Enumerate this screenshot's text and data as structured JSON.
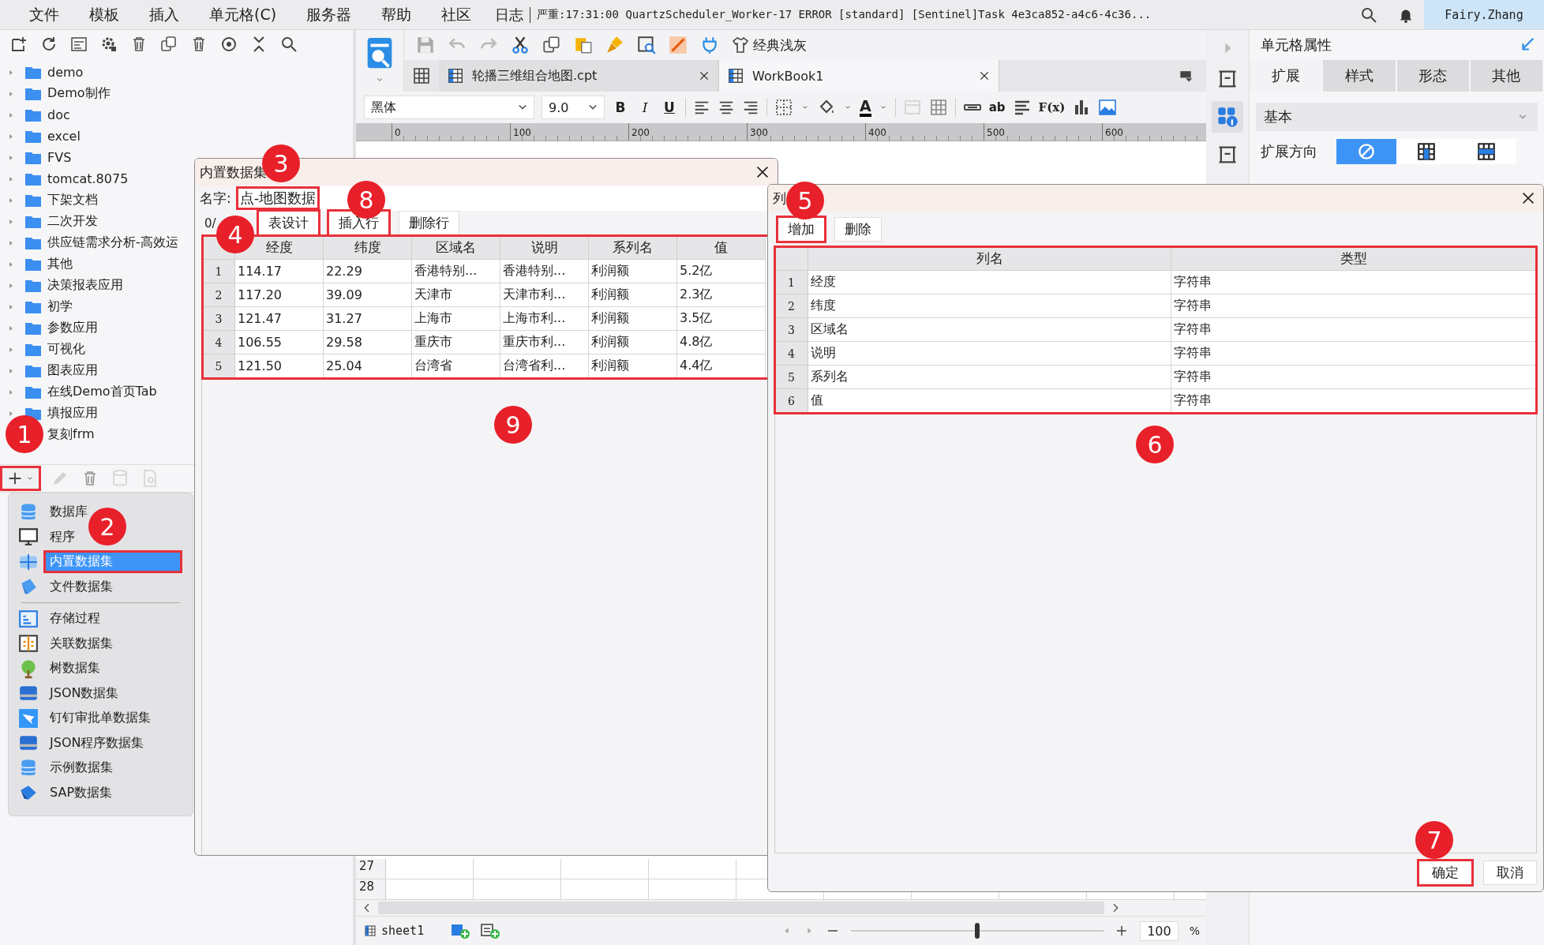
{
  "menu_bar": {
    "items": [
      "文件",
      "模板",
      "插入",
      "单元格(C)",
      "服务器",
      "帮助",
      "社区"
    ],
    "log_label": "日志",
    "log_message": "严重:17:31:00 QuartzScheduler_Worker-17 ERROR [standard] [Sentinel]Task 4e3ca852-a4c6-4c36...",
    "user": "Fairy.Zhang"
  },
  "template_tree": {
    "items": [
      {
        "label": "demo"
      },
      {
        "label": "Demo制作"
      },
      {
        "label": "doc"
      },
      {
        "label": "excel"
      },
      {
        "label": "FVS"
      },
      {
        "label": "tomcat.8075"
      },
      {
        "label": "下架文档"
      },
      {
        "label": "二次开发"
      },
      {
        "label": "供应链需求分析-高效运"
      },
      {
        "label": "其他"
      },
      {
        "label": "决策报表应用"
      },
      {
        "label": "初学"
      },
      {
        "label": "参数应用"
      },
      {
        "label": "可视化"
      },
      {
        "label": "图表应用"
      },
      {
        "label": "在线Demo首页Tab"
      },
      {
        "label": "填报应用"
      },
      {
        "label": "复刻frm"
      }
    ]
  },
  "data_toolbar": {
    "add_button": {
      "highlighted": true
    }
  },
  "add_menu": {
    "sections": [
      {
        "items": [
          {
            "label": "数据库",
            "selected": false,
            "highlighted": false
          },
          {
            "label": "程序",
            "selected": false,
            "highlighted": false
          },
          {
            "label": "内置数据集",
            "selected": true,
            "highlighted": true
          },
          {
            "label": "文件数据集",
            "selected": false,
            "highlighted": false
          }
        ]
      },
      {
        "items": [
          {
            "label": "存储过程",
            "selected": false,
            "highlighted": false
          },
          {
            "label": "关联数据集",
            "selected": false,
            "highlighted": false
          },
          {
            "label": "树数据集",
            "selected": false,
            "highlighted": false
          },
          {
            "label": "JSON数据集",
            "selected": false,
            "highlighted": false
          },
          {
            "label": "钉钉审批单数据集",
            "selected": false,
            "highlighted": false
          },
          {
            "label": "JSON程序数据集",
            "selected": false,
            "highlighted": false
          },
          {
            "label": "示例数据集",
            "selected": false,
            "highlighted": false
          },
          {
            "label": "SAP数据集",
            "selected": false,
            "highlighted": false
          }
        ]
      }
    ]
  },
  "editor": {
    "theme_button": "经典浅灰",
    "tabs": [
      {
        "label": "轮播三维组合地图.cpt",
        "selected": false
      },
      {
        "label": "WorkBook1",
        "selected": true
      }
    ],
    "font": "黑体",
    "font_size": "9.0",
    "style_buttons": [
      "B",
      "I",
      "U"
    ],
    "font_color_glyph": "A",
    "text_tools": [
      "ab",
      "F(x)"
    ],
    "ruler": [
      "0",
      "100",
      "200",
      "300",
      "400",
      "500",
      "600"
    ],
    "row_numbers": [
      "27",
      "28"
    ],
    "sheet_tab": "sheet1",
    "zoom_slider": {
      "level": 0.5
    },
    "zoom": "100",
    "zoom_unit": "%"
  },
  "cell_properties": {
    "title": "单元格属性",
    "tabs": [
      {
        "label": "扩展",
        "selected": true
      },
      {
        "label": "样式",
        "selected": false
      },
      {
        "label": "形态",
        "selected": false
      },
      {
        "label": "其他",
        "selected": false
      }
    ],
    "section": "基本",
    "direction_label": "扩展方向",
    "direction_options": [
      {
        "kind": "none",
        "selected": true
      },
      {
        "kind": "vertical",
        "selected": false
      },
      {
        "kind": "horizontal",
        "selected": false
      }
    ]
  },
  "dataset_dialog": {
    "title": "内置数据集",
    "name_label": "名字:",
    "name_value": "点-地图数据",
    "name_highlighted": true,
    "row_count": "0/",
    "buttons": [
      {
        "label": "表设计",
        "highlighted": true
      },
      {
        "label": "插入行",
        "highlighted": true
      },
      {
        "label": "删除行",
        "highlighted": false
      }
    ],
    "table": {
      "highlighted": true,
      "columns": [
        "经度",
        "纬度",
        "区域名",
        "说明",
        "系列名",
        "值"
      ],
      "rows": [
        {
          "index": "1",
          "cells": [
            "114.17",
            "22.29",
            "香港特别...",
            "香港特别...",
            "利润额",
            "5.2亿"
          ]
        },
        {
          "index": "2",
          "cells": [
            "117.20",
            "39.09",
            "天津市",
            "天津市利...",
            "利润额",
            "2.3亿"
          ]
        },
        {
          "index": "3",
          "cells": [
            "121.47",
            "31.27",
            "上海市",
            "上海市利...",
            "利润额",
            "3.5亿"
          ]
        },
        {
          "index": "4",
          "cells": [
            "106.55",
            "29.58",
            "重庆市",
            "重庆市利...",
            "利润额",
            "4.8亿"
          ]
        },
        {
          "index": "5",
          "cells": [
            "121.50",
            "25.04",
            "台湾省",
            "台湾省利...",
            "利润额",
            "4.4亿"
          ]
        }
      ]
    }
  },
  "columns_dialog": {
    "title": "列",
    "buttons": [
      {
        "label": "增加",
        "highlighted": true
      },
      {
        "label": "删除",
        "highlighted": false
      }
    ],
    "table": {
      "highlighted": true,
      "columns": [
        "列名",
        "类型"
      ],
      "rows": [
        {
          "index": "1",
          "cells": [
            "经度",
            "字符串"
          ]
        },
        {
          "index": "2",
          "cells": [
            "纬度",
            "字符串"
          ]
        },
        {
          "index": "3",
          "cells": [
            "区域名",
            "字符串"
          ]
        },
        {
          "index": "4",
          "cells": [
            "说明",
            "字符串"
          ]
        },
        {
          "index": "5",
          "cells": [
            "系列名",
            "字符串"
          ]
        },
        {
          "index": "6",
          "cells": [
            "值",
            "字符串"
          ]
        }
      ]
    },
    "footer_buttons": [
      {
        "label": "确定",
        "highlighted": true
      },
      {
        "label": "取消",
        "highlighted": false
      }
    ]
  },
  "callouts": [
    {
      "number": "1"
    },
    {
      "number": "2"
    },
    {
      "number": "3"
    },
    {
      "number": "4"
    },
    {
      "number": "5"
    },
    {
      "number": "6"
    },
    {
      "number": "7"
    },
    {
      "number": "8"
    },
    {
      "number": "9"
    }
  ]
}
